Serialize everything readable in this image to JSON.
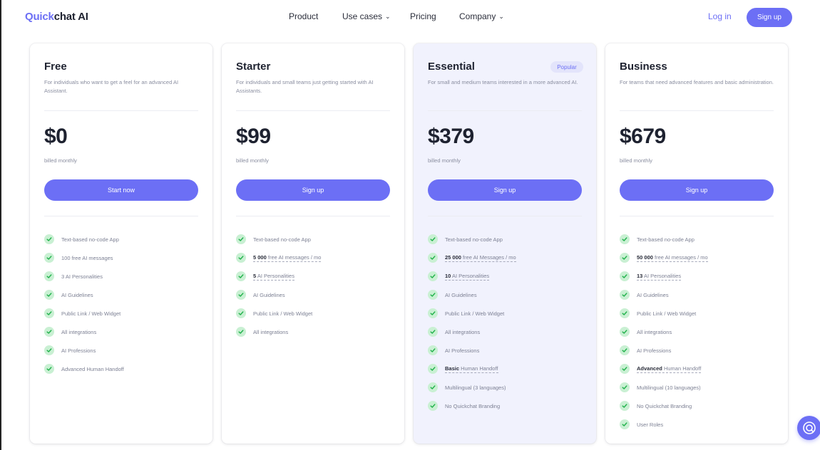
{
  "brand": {
    "part1": "Quick",
    "part2": "chat AI"
  },
  "nav": {
    "product": "Product",
    "use_cases": "Use cases",
    "pricing": "Pricing",
    "company": "Company",
    "login": "Log in",
    "signup": "Sign up"
  },
  "colors": {
    "accent": "#6c6ff5",
    "check_bg": "#c9f0d3",
    "check_mark": "#22b24c",
    "popular_bg": "#f1f2fd"
  },
  "plans": [
    {
      "name": "Free",
      "badge": "",
      "description": "For individuals who want to get a feel for an advanced AI Assistant.",
      "price": "$0",
      "billing": "billed monthly",
      "cta": "Start now",
      "features": [
        {
          "bold": "",
          "text": "Text-based no-code App"
        },
        {
          "bold": "",
          "text": "100 free AI messages"
        },
        {
          "bold": "",
          "text": "3 AI Personalities"
        },
        {
          "bold": "",
          "text": "AI Guidelines"
        },
        {
          "bold": "",
          "text": "Public Link / Web Widget"
        },
        {
          "bold": "",
          "text": "All integrations"
        },
        {
          "bold": "",
          "text": "AI Professions"
        },
        {
          "bold": "",
          "text": "Advanced Human Handoff"
        }
      ]
    },
    {
      "name": "Starter",
      "badge": "",
      "description": "For individuals and small teams just getting started with AI Assistants.",
      "price": "$99",
      "billing": "billed monthly",
      "cta": "Sign up",
      "features": [
        {
          "bold": "",
          "text": "Text-based no-code App"
        },
        {
          "bold": "5 000",
          "text": " free AI messages / mo"
        },
        {
          "bold": "5",
          "text": " AI Personalities"
        },
        {
          "bold": "",
          "text": "AI Guidelines"
        },
        {
          "bold": "",
          "text": "Public Link / Web Widget"
        },
        {
          "bold": "",
          "text": "All integrations"
        }
      ]
    },
    {
      "name": "Essential",
      "badge": "Popular",
      "description": "For small and medium teams interested in a more advanced AI.",
      "price": "$379",
      "billing": "billed monthly",
      "cta": "Sign up",
      "features": [
        {
          "bold": "",
          "text": "Text-based no-code App"
        },
        {
          "bold": "25 000",
          "text": " free AI Messages / mo"
        },
        {
          "bold": "10",
          "text": " AI Personalities"
        },
        {
          "bold": "",
          "text": "AI Guidelines"
        },
        {
          "bold": "",
          "text": "Public Link / Web Widget"
        },
        {
          "bold": "",
          "text": "All integrations"
        },
        {
          "bold": "",
          "text": "AI Professions"
        },
        {
          "bold": "Basic",
          "text": " Human Handoff"
        },
        {
          "bold": "",
          "text": "Multilingual (3 languages)"
        },
        {
          "bold": "",
          "text": "No Quickchat Branding"
        }
      ]
    },
    {
      "name": "Business",
      "badge": "",
      "description": "For teams that need advanced features and basic administration.",
      "price": "$679",
      "billing": "billed monthly",
      "cta": "Sign up",
      "features": [
        {
          "bold": "",
          "text": "Text-based no-code App"
        },
        {
          "bold": "50 000",
          "text": " free AI messages / mo"
        },
        {
          "bold": "13",
          "text": " AI Personalities"
        },
        {
          "bold": "",
          "text": "AI Guidelines"
        },
        {
          "bold": "",
          "text": "Public Link / Web Widget"
        },
        {
          "bold": "",
          "text": "All integrations"
        },
        {
          "bold": "",
          "text": "AI Professions"
        },
        {
          "bold": "Advanced",
          "text": " Human Handoff"
        },
        {
          "bold": "",
          "text": "Multilingual (10 languages)"
        },
        {
          "bold": "",
          "text": "No Quickchat Branding"
        },
        {
          "bold": "",
          "text": "User Roles"
        }
      ]
    }
  ]
}
